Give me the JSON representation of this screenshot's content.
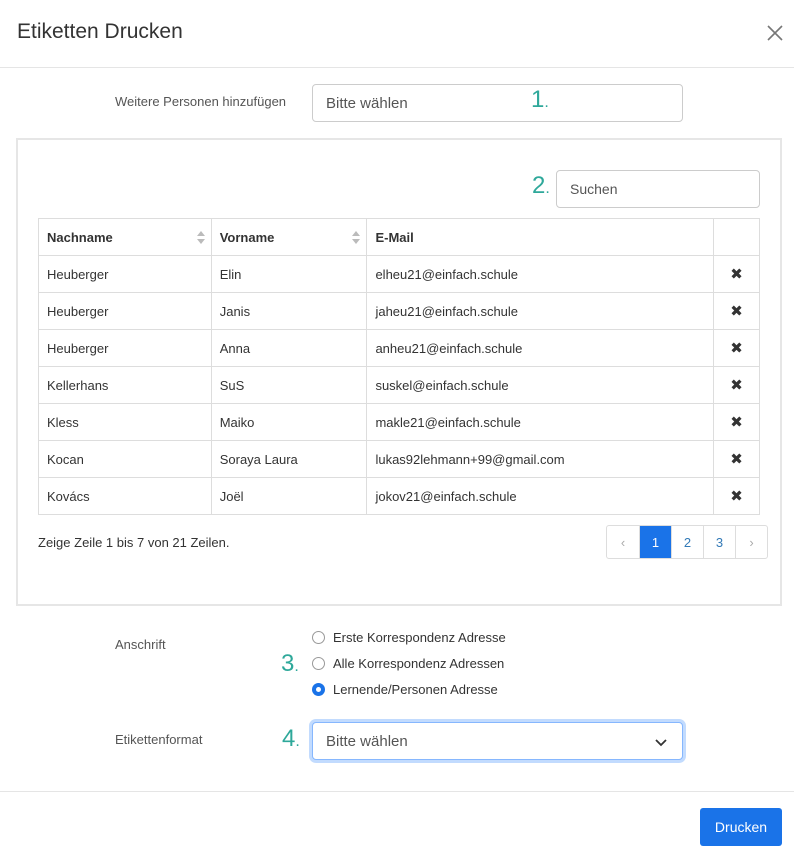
{
  "dialog": {
    "title": "Etiketten Drucken"
  },
  "add_persons": {
    "label": "Weitere Personen hinzufügen",
    "placeholder": "Bitte wählen"
  },
  "steps": [
    "1",
    "2",
    "3",
    "4"
  ],
  "search": {
    "placeholder": "Suchen"
  },
  "table": {
    "headers": [
      "Nachname",
      "Vorname",
      "E-Mail"
    ],
    "rows": [
      [
        "Heuberger",
        "Elin",
        "elheu21@einfach.schule"
      ],
      [
        "Heuberger",
        "Janis",
        "jaheu21@einfach.schule"
      ],
      [
        "Heuberger",
        "Anna",
        "anheu21@einfach.schule"
      ],
      [
        "Kellerhans",
        "SuS",
        "suskel@einfach.schule"
      ],
      [
        "Kless",
        "Maiko",
        "makle21@einfach.schule"
      ],
      [
        "Kocan",
        "Soraya Laura",
        "lukas92lehmann+99@gmail.com"
      ],
      [
        "Kovács",
        "Joël",
        "jokov21@einfach.schule"
      ]
    ],
    "delete_symbol": "✖"
  },
  "pagination": {
    "info": "Zeige Zeile 1 bis 7 von 21 Zeilen.",
    "prev": "‹",
    "pages": [
      "1",
      "2",
      "3"
    ],
    "next": "›",
    "active_page": "1"
  },
  "address": {
    "label": "Anschrift",
    "options": [
      "Erste Korrespondenz Adresse",
      "Alle Korrespondenz Adressen",
      "Lernende/Personen Adresse"
    ],
    "selected": "Lernende/Personen Adresse"
  },
  "format": {
    "label": "Etikettenformat",
    "value": "Bitte wählen"
  },
  "footer": {
    "print_label": "Drucken"
  },
  "colors": {
    "accent": "#1a73e8",
    "step": "#2ea89a"
  }
}
